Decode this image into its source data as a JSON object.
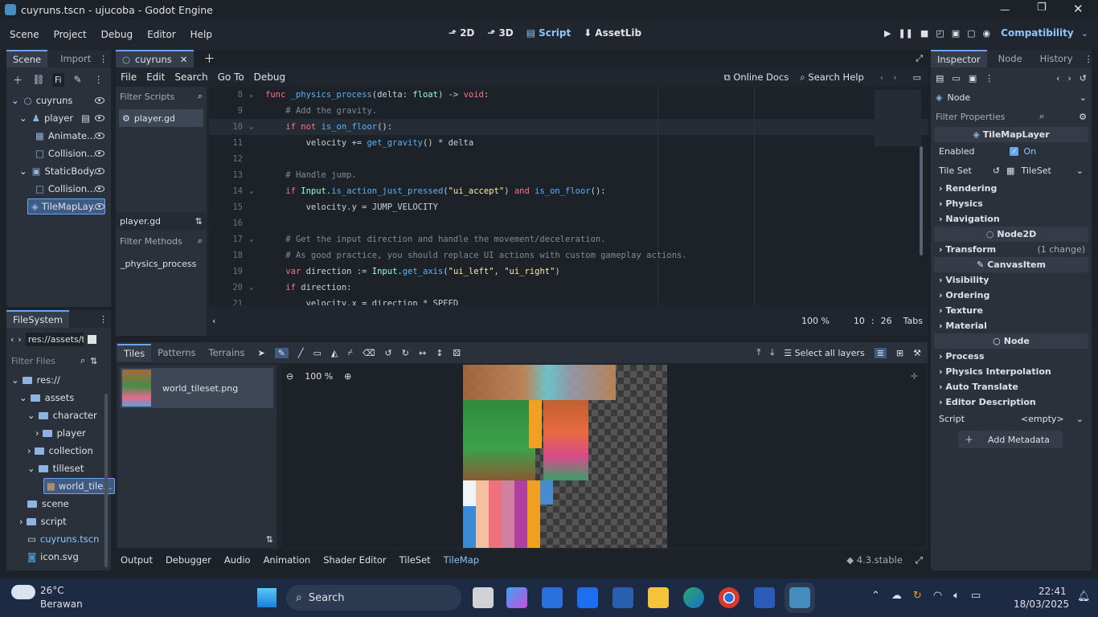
{
  "window": {
    "title": "cuyruns.tscn - ujucoba - Godot Engine"
  },
  "menubar": {
    "items": [
      "Scene",
      "Project",
      "Debug",
      "Editor",
      "Help"
    ],
    "workspaces": [
      "2D",
      "3D",
      "Script",
      "AssetLib"
    ],
    "renderer": "Compatibility"
  },
  "scene_dock": {
    "tabs": [
      "Scene",
      "Import"
    ],
    "filter": "Fi",
    "nodes": [
      "cuyruns",
      "player",
      "Animate...",
      "Collision...",
      "StaticBody...",
      "Collision...",
      "TileMapLay..."
    ]
  },
  "filesystem": {
    "tab": "FileSystem",
    "path": "res://assets/ti",
    "filter_placeholder": "Filter Files",
    "items": [
      "res://",
      "assets",
      "character",
      "player",
      "collection",
      "tilleset",
      "world_tile...",
      "scene",
      "script",
      "cuyruns.tscn",
      "icon.svg"
    ]
  },
  "editor_tabs": {
    "scene_tab": "cuyruns"
  },
  "script_menu": {
    "items": [
      "File",
      "Edit",
      "Search",
      "Go To",
      "Debug"
    ],
    "online_docs": "Online Docs",
    "search_help": "Search Help"
  },
  "script_list": {
    "filter_scripts": "Filter Scripts",
    "current": "player.gd",
    "label": "player.gd",
    "filter_methods": "Filter Methods",
    "method": "_physics_process"
  },
  "code": {
    "lines": [
      {
        "n": "8",
        "t": [
          [
            "kw",
            "func "
          ],
          [
            "fn",
            "_physics_process"
          ],
          [
            "tx",
            "(delta: "
          ],
          [
            "ty",
            "float"
          ],
          [
            "tx",
            ") -> "
          ],
          [
            "kw",
            "void"
          ],
          [
            "tx",
            ":"
          ]
        ]
      },
      {
        "n": "9",
        "t": [
          [
            "tx",
            "    "
          ],
          [
            "cm",
            "# Add the gravity."
          ]
        ]
      },
      {
        "n": "10",
        "t": [
          [
            "tx",
            "    "
          ],
          [
            "kw",
            "if not "
          ],
          [
            "fn",
            "is_on_floor"
          ],
          [
            "tx",
            "():"
          ]
        ]
      },
      {
        "n": "11",
        "t": [
          [
            "tx",
            "        velocity += "
          ],
          [
            "fn",
            "get_gravity"
          ],
          [
            "tx",
            "() * delta"
          ]
        ]
      },
      {
        "n": "12",
        "t": []
      },
      {
        "n": "13",
        "t": [
          [
            "tx",
            "    "
          ],
          [
            "cm",
            "# Handle jump."
          ]
        ]
      },
      {
        "n": "14",
        "t": [
          [
            "tx",
            "    "
          ],
          [
            "kw",
            "if "
          ],
          [
            "ty",
            "Input"
          ],
          [
            "tx",
            "."
          ],
          [
            "fn",
            "is_action_just_pressed"
          ],
          [
            "tx",
            "("
          ],
          [
            "st",
            "\"ui_accept\""
          ],
          [
            "tx",
            ") "
          ],
          [
            "kw",
            "and "
          ],
          [
            "fn",
            "is_on_floor"
          ],
          [
            "tx",
            "():"
          ]
        ]
      },
      {
        "n": "15",
        "t": [
          [
            "tx",
            "        velocity.y = JUMP_VELOCITY"
          ]
        ]
      },
      {
        "n": "16",
        "t": []
      },
      {
        "n": "17",
        "t": [
          [
            "tx",
            "    "
          ],
          [
            "cm",
            "# Get the input direction and handle the movement/deceleration."
          ]
        ]
      },
      {
        "n": "18",
        "t": [
          [
            "tx",
            "    "
          ],
          [
            "cm",
            "# As good practice, you should replace UI actions with custom gameplay actions."
          ]
        ]
      },
      {
        "n": "19",
        "t": [
          [
            "tx",
            "    "
          ],
          [
            "kw",
            "var "
          ],
          [
            "tx",
            "direction := "
          ],
          [
            "ty",
            "Input"
          ],
          [
            "tx",
            "."
          ],
          [
            "fn",
            "get_axis"
          ],
          [
            "tx",
            "("
          ],
          [
            "st",
            "\"ui_left\""
          ],
          [
            "tx",
            ", "
          ],
          [
            "st",
            "\"ui_right\""
          ],
          [
            "tx",
            ")"
          ]
        ]
      },
      {
        "n": "20",
        "t": [
          [
            "tx",
            "    "
          ],
          [
            "kw",
            "if "
          ],
          [
            "tx",
            "direction:"
          ]
        ]
      },
      {
        "n": "21",
        "t": [
          [
            "tx",
            "        velocity.x = direction * SPEED"
          ]
        ]
      }
    ],
    "zoom": "100 %",
    "line": "10",
    "col": "26",
    "indent": "Tabs"
  },
  "tilemap": {
    "tabs": [
      "Tiles",
      "Patterns",
      "Terrains"
    ],
    "select_layers": "Select all layers",
    "source": "world_tileset.png",
    "zoom": "100 %"
  },
  "bottom_tabs": {
    "items": [
      "Output",
      "Debugger",
      "Audio",
      "Animation",
      "Shader Editor",
      "TileSet",
      "TileMap"
    ],
    "version": "4.3.stable"
  },
  "inspector": {
    "tabs": [
      "Inspector",
      "Node",
      "History"
    ],
    "node": "Node",
    "filter": "Filter Properties",
    "class": "TileMapLayer",
    "enabled_label": "Enabled",
    "enabled_value": "On",
    "tileset_label": "Tile Set",
    "tileset_value": "TileSet",
    "sections1": [
      "Rendering",
      "Physics",
      "Navigation"
    ],
    "node2d": "Node2D",
    "transform": "Transform",
    "transform_note": "(1 change)",
    "canvasitem": "CanvasItem",
    "sections2": [
      "Visibility",
      "Ordering",
      "Texture",
      "Material"
    ],
    "sections3": [
      "Process",
      "Physics Interpolation",
      "Auto Translate",
      "Editor Description"
    ],
    "script_label": "Script",
    "script_value": "<empty>",
    "add_metadata": "Add Metadata"
  },
  "taskbar": {
    "temp": "26°C",
    "weather": "Berawan",
    "search": "Search",
    "time": "22:41",
    "date": "18/03/2025"
  },
  "colors": {
    "accent": "#6ba3ed",
    "bg": "#1d2229",
    "panel": "#2b313a"
  }
}
